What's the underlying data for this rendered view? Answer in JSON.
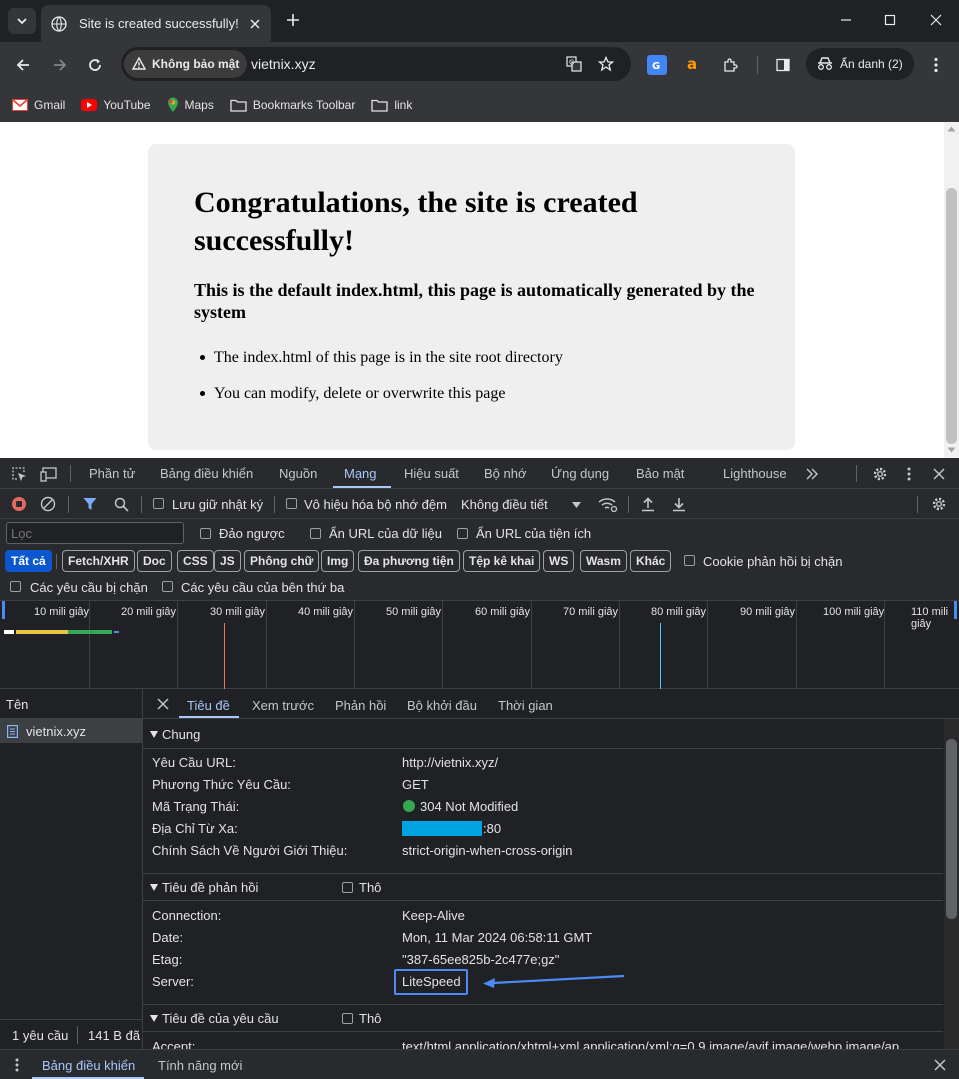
{
  "browser": {
    "tab_title": "Site is created successfully!",
    "security_label": "Không bảo mật",
    "url": "vietnix.xyz",
    "incognito_label": "Ẩn danh (2)",
    "bookmarks": [
      {
        "label": "Gmail",
        "icon": "gmail-icon"
      },
      {
        "label": "YouTube",
        "icon": "youtube-icon"
      },
      {
        "label": "Maps",
        "icon": "maps-icon"
      },
      {
        "label": "Bookmarks Toolbar",
        "icon": "folder-icon"
      },
      {
        "label": "link",
        "icon": "folder-icon"
      }
    ]
  },
  "page": {
    "heading": "Congratulations, the site is created successfully!",
    "subheading": "This is the default index.html, this page is automatically generated by the system",
    "bullets": [
      "The index.html of this page is in the site root directory",
      "You can modify, delete or overwrite this page"
    ]
  },
  "devtools": {
    "tabs": [
      "Phần tử",
      "Bảng điều khiển",
      "Nguồn",
      "Mạng",
      "Hiệu suất",
      "Bộ nhớ",
      "Ứng dụng",
      "Bảo mật",
      "Lighthouse"
    ],
    "active_tab": "Mạng",
    "toolbar": {
      "preserve_log": "Lưu giữ nhật ký",
      "disable_cache": "Vô hiệu hóa bộ nhớ đệm",
      "throttling": "Không điều tiết"
    },
    "filter": {
      "placeholder": "Lọc",
      "invert": "Đảo ngược",
      "hide_data_urls": "Ẩn URL của dữ liệu",
      "hide_extension_urls": "Ẩn URL của tiện ích",
      "types": [
        "Tất cả",
        "Fetch/XHR",
        "Doc",
        "CSS",
        "JS",
        "Phông chữ",
        "Img",
        "Đa phương tiện",
        "Tệp kê khai",
        "WS",
        "Wasm",
        "Khác"
      ],
      "blocked_cookies": "Cookie phản hồi bị chặn",
      "blocked_requests": "Các yêu cầu bị chặn",
      "third_party": "Các yêu cầu của bên thứ ba"
    },
    "timeline_labels": [
      "10 mili giây",
      "20 mili giây",
      "30 mili giây",
      "40 mili giây",
      "50 mili giây",
      "60 mili giây",
      "70 mili giây",
      "80 mili giây",
      "90 mili giây",
      "100 mili giây",
      "110 mili giây"
    ],
    "name_header": "Tên",
    "request_name": "vietnix.xyz",
    "status_summary": {
      "requests": "1 yêu cầu",
      "transferred": "141 B đã"
    },
    "detail_tabs": [
      "Tiêu đề",
      "Xem trước",
      "Phản hồi",
      "Bộ khởi đầu",
      "Thời gian"
    ],
    "active_detail_tab": "Tiêu đề",
    "general": {
      "title": "Chung",
      "rows": [
        {
          "key": "Yêu Cầu URL:",
          "value": "http://vietnix.xyz/"
        },
        {
          "key": "Phương Thức Yêu Cầu:",
          "value": "GET"
        },
        {
          "key": "Mã Trạng Thái:",
          "value": "304 Not Modified"
        },
        {
          "key": "Địa Chỉ Từ Xa:",
          "value": ":80"
        },
        {
          "key": "Chính Sách Về Người Giới Thiệu:",
          "value": "strict-origin-when-cross-origin"
        }
      ]
    },
    "response_headers": {
      "title": "Tiêu đề phản hồi",
      "raw_label": "Thô",
      "rows": [
        {
          "key": "Connection:",
          "value": "Keep-Alive"
        },
        {
          "key": "Date:",
          "value": "Mon, 11 Mar 2024 06:58:11 GMT"
        },
        {
          "key": "Etag:",
          "value": "\"387-65ee825b-2c477e;gz\""
        },
        {
          "key": "Server:",
          "value": "LiteSpeed"
        }
      ]
    },
    "request_headers": {
      "title": "Tiêu đề của yêu cầu",
      "raw_label": "Thô",
      "rows": [
        {
          "key": "Accept:",
          "value": "text/html,application/xhtml+xml,application/xml;q=0.9,image/avif,image/webp,image/ap"
        }
      ]
    },
    "drawer_tabs": [
      "Bảng điều khiển",
      "Tính năng mới"
    ],
    "colors": {
      "status_ok": "#34a853",
      "accent": "#a8c7fa",
      "highlight": "#4c8bf5",
      "redact": "#00a3e0"
    }
  }
}
